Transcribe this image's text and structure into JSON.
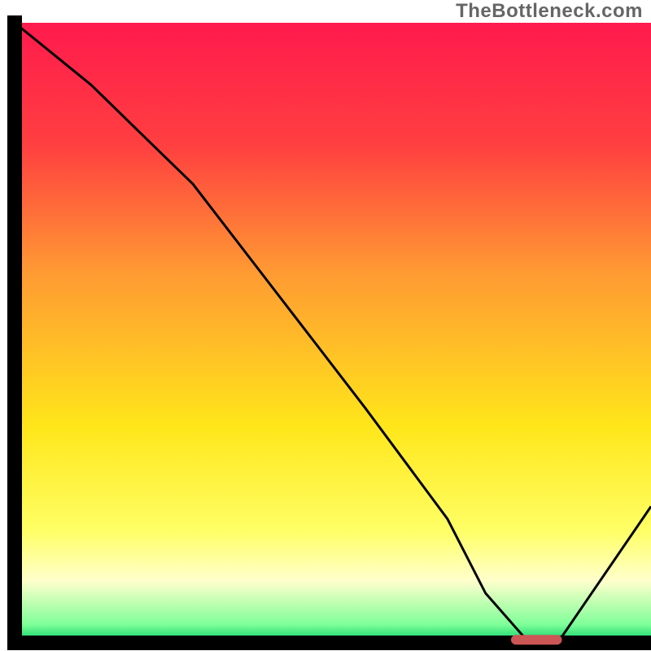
{
  "watermark": "TheBottleneck.com",
  "chart_data": {
    "type": "line",
    "title": "",
    "xlabel": "",
    "ylabel": "",
    "xlim": [
      0,
      100
    ],
    "ylim": [
      0,
      100
    ],
    "grid": false,
    "background_gradient": {
      "stops": [
        {
          "offset": 0.0,
          "color": "#ff1a4d"
        },
        {
          "offset": 0.2,
          "color": "#ff4040"
        },
        {
          "offset": 0.4,
          "color": "#ff9933"
        },
        {
          "offset": 0.65,
          "color": "#ffe61a"
        },
        {
          "offset": 0.82,
          "color": "#ffff66"
        },
        {
          "offset": 0.9,
          "color": "#ffffcc"
        },
        {
          "offset": 0.97,
          "color": "#80ff99"
        },
        {
          "offset": 1.0,
          "color": "#00cc66"
        }
      ]
    },
    "series": [
      {
        "name": "bottleneck-curve",
        "x": [
          0,
          6,
          12,
          22,
          28,
          40,
          55,
          68,
          74,
          80,
          86,
          92,
          100
        ],
        "y": [
          100,
          95,
          90,
          80,
          74,
          58,
          38,
          20,
          8,
          1,
          1,
          10,
          22
        ]
      }
    ],
    "marker": {
      "name": "optimal-range",
      "x_start": 78,
      "x_end": 86,
      "y": 0.5,
      "color": "#cc5555"
    }
  }
}
